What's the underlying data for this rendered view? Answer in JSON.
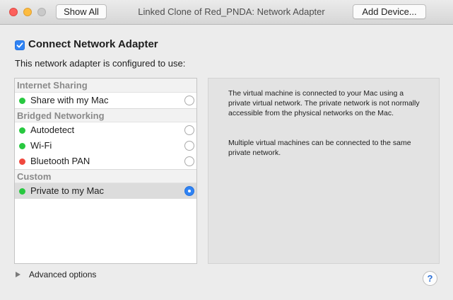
{
  "titlebar": {
    "title": "Linked Clone of Red_PNDA: Network Adapter",
    "show_all_label": "Show All",
    "add_device_label": "Add Device..."
  },
  "connect": {
    "label": "Connect Network Adapter",
    "checked": true,
    "accent_color": "#2f83f4"
  },
  "configured_text": "This network adapter is configured to use:",
  "adapter_list": {
    "groups": [
      {
        "header": "Internet Sharing",
        "items": [
          {
            "label": "Share with my Mac",
            "status": "green",
            "selected": false
          }
        ]
      },
      {
        "header": "Bridged Networking",
        "items": [
          {
            "label": "Autodetect",
            "status": "green",
            "selected": false
          },
          {
            "label": "Wi-Fi",
            "status": "green",
            "selected": false
          },
          {
            "label": "Bluetooth PAN",
            "status": "red",
            "selected": false
          }
        ]
      },
      {
        "header": "Custom",
        "items": [
          {
            "label": "Private to my Mac",
            "status": "green",
            "selected": true
          }
        ]
      }
    ]
  },
  "description": {
    "paragraph1": "The virtual machine is connected to your Mac using a private virtual network. The private network is not normally accessible from the physical networks on the Mac.",
    "paragraph2": "Multiple virtual machines can be connected to the same private network."
  },
  "advanced_options_label": "Advanced options",
  "help_label": "?",
  "colors": {
    "status_green": "#28c840",
    "status_red": "#f0483e",
    "selection": "#dcdcdc"
  }
}
